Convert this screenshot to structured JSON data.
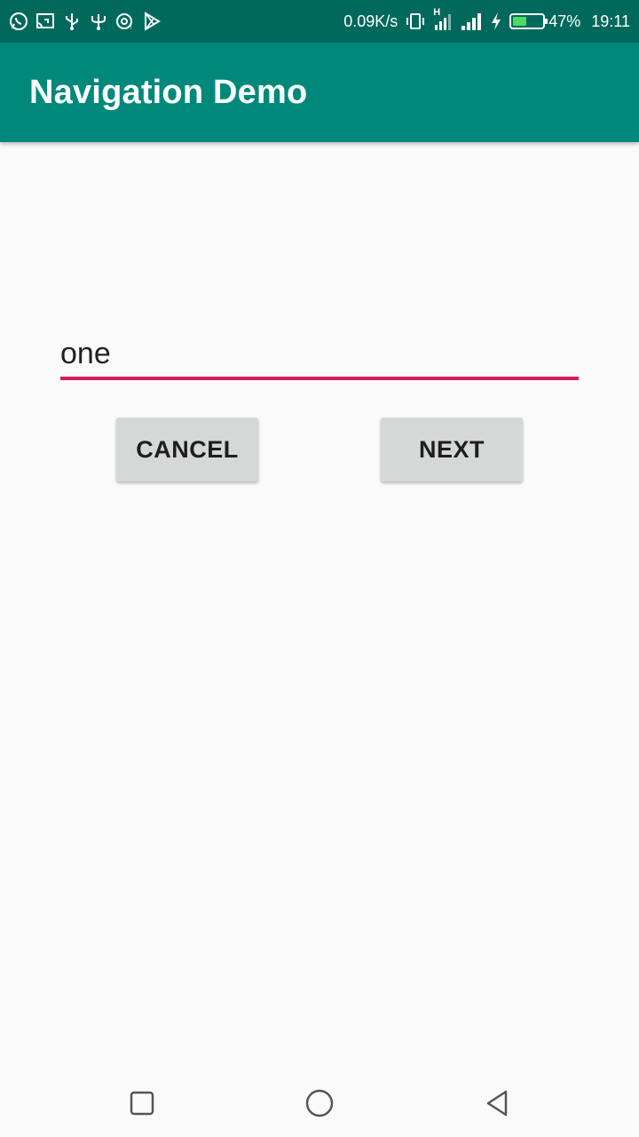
{
  "status_bar": {
    "net_speed": "0.09K/s",
    "network_type": "H",
    "battery_percent": "47%",
    "battery_level": 0.47,
    "battery_color": "#4cd964",
    "time": "19:11",
    "left_icons": [
      "whatsapp-icon",
      "screen-cast-icon",
      "usb-icon",
      "usb-debug-icon",
      "sync-icon",
      "play-store-icon"
    ],
    "right_icons": [
      "vibrate-icon",
      "network-h-icon",
      "signal-icon",
      "charging-icon",
      "battery-icon"
    ]
  },
  "app_bar": {
    "title": "Navigation Demo",
    "color": "#00897b"
  },
  "form": {
    "text_value": "one",
    "underline_color": "#d81b60",
    "cancel_label": "CANCEL",
    "next_label": "NEXT"
  },
  "nav_bar": {
    "icons": [
      "recent-apps-icon",
      "home-icon",
      "back-icon"
    ]
  }
}
